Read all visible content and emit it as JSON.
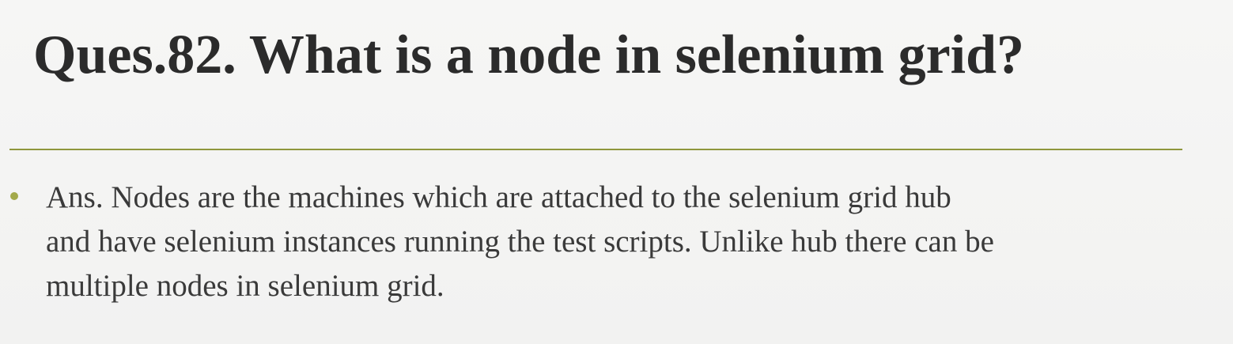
{
  "slide": {
    "title": "Ques.82. What is a node in selenium grid?",
    "bullets": [
      {
        "lines": [
          "Ans. Nodes are the machines which are attached to the selenium grid hub",
          "and have selenium instances running the test scripts. Unlike hub there can be",
          "multiple nodes in selenium grid."
        ]
      }
    ]
  },
  "colors": {
    "background": "#f4f4f3",
    "title_text": "#2b2b2b",
    "body_text": "#3a3a3a",
    "rule": "#8f963c",
    "bullet": "#a3a94a"
  }
}
